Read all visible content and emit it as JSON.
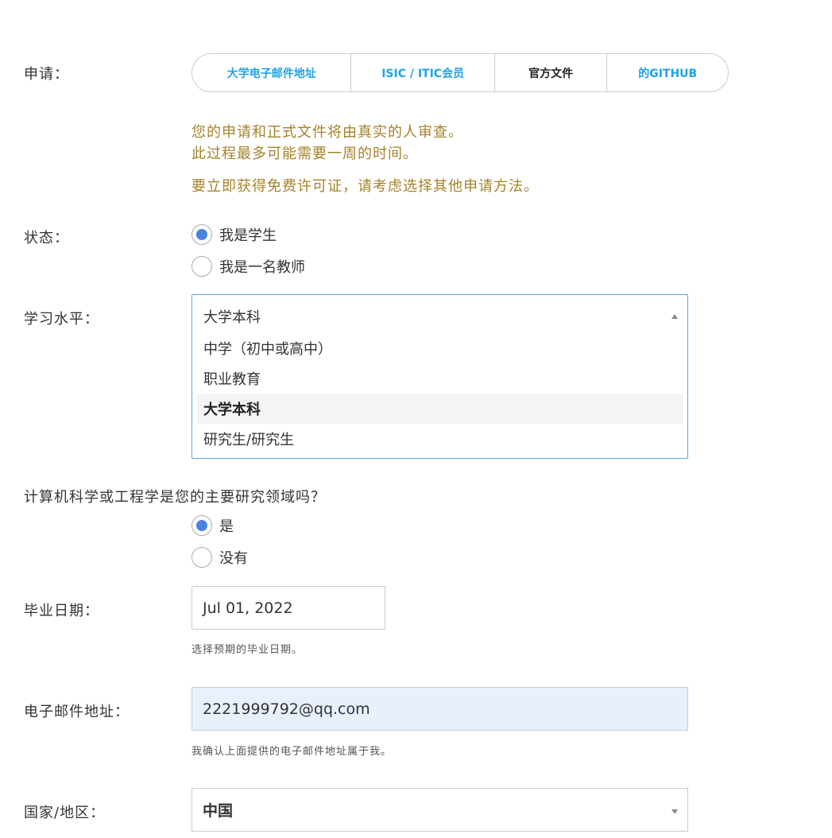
{
  "apply": {
    "label": "申请：",
    "tabs": [
      {
        "label": "大学电子邮件地址",
        "active": false
      },
      {
        "label": "ISIC / ITIC会员",
        "active": false
      },
      {
        "label": "官方文件",
        "active": true
      },
      {
        "label": "的GITHUB",
        "active": false
      }
    ]
  },
  "notice": {
    "line1": "您的申请和正式文件将由真实的人审查。",
    "line2": "此过程最多可能需要一周的时间。",
    "line3": "要立即获得免费许可证，请考虑选择其他申请方法。"
  },
  "status": {
    "label": "状态：",
    "options": [
      {
        "label": "我是学生",
        "checked": true
      },
      {
        "label": "我是一名教师",
        "checked": false
      }
    ]
  },
  "study_level": {
    "label": "学习水平：",
    "selected": "大学本科",
    "options": [
      "中学（初中或高中）",
      "职业教育",
      "大学本科",
      "研究生/研究生"
    ]
  },
  "cs_question": {
    "label": "计算机科学或工程学是您的主要研究领域吗？",
    "options": [
      {
        "label": "是",
        "checked": true
      },
      {
        "label": "没有",
        "checked": false
      }
    ]
  },
  "graduation": {
    "label": "毕业日期：",
    "value": "Jul 01, 2022",
    "hint": "选择预期的毕业日期。"
  },
  "email": {
    "label": "电子邮件地址：",
    "value": "2221999792@qq.com",
    "hint": "我确认上面提供的电子邮件地址属于我。"
  },
  "country": {
    "label": "国家/地区：",
    "value": "中国"
  },
  "colors": {
    "accent": "#1ea3e8",
    "notice": "#a5822a",
    "radio_checked": "#4a83dc",
    "autofill_bg": "#e8f0fe"
  }
}
